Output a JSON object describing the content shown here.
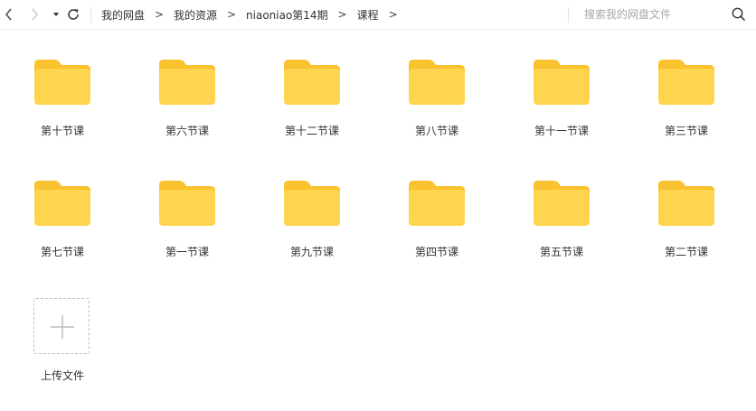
{
  "toolbar": {
    "back_icon": "chevron-left-icon",
    "forward_icon": "chevron-right-icon",
    "dropdown_icon": "triangle-down-icon",
    "refresh_icon": "refresh-icon",
    "search_icon": "magnifier-icon"
  },
  "breadcrumb": {
    "items": [
      "我的网盘",
      "我的资源",
      "niaoniao第14期",
      "课程"
    ],
    "separator": ">"
  },
  "search": {
    "placeholder": "搜索我的网盘文件"
  },
  "folders": [
    {
      "label": "第十节课"
    },
    {
      "label": "第六节课"
    },
    {
      "label": "第十二节课"
    },
    {
      "label": "第八节课"
    },
    {
      "label": "第十一节课"
    },
    {
      "label": "第三节课"
    },
    {
      "label": "第七节课"
    },
    {
      "label": "第一节课"
    },
    {
      "label": "第九节课"
    },
    {
      "label": "第四节课"
    },
    {
      "label": "第五节课"
    },
    {
      "label": "第二节课"
    }
  ],
  "upload": {
    "label": "上传文件",
    "icon": "plus-icon"
  },
  "colors": {
    "folder_body": "#FFD54F",
    "folder_tab": "#F9C22E",
    "text": "#333333",
    "placeholder": "#A8A8A8"
  }
}
